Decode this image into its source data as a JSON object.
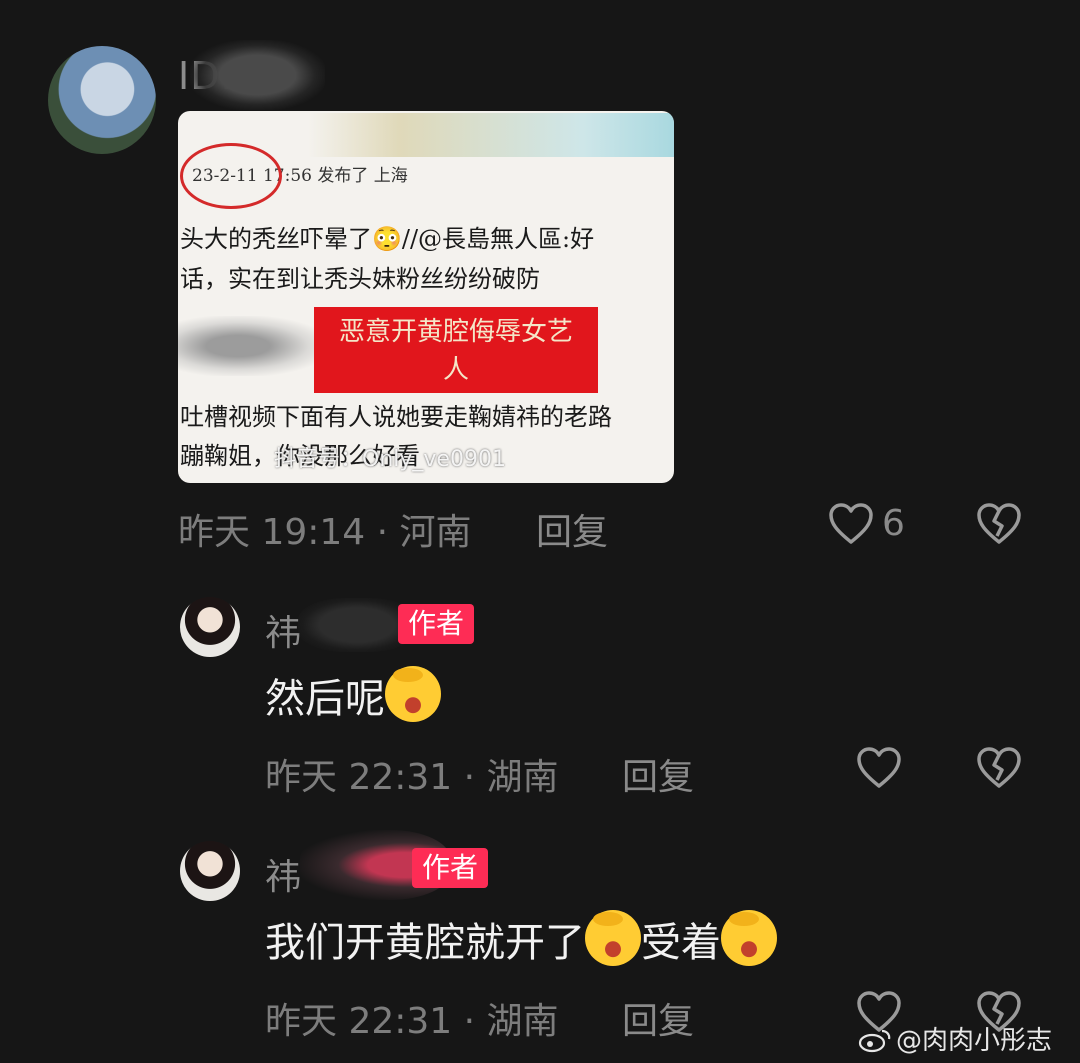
{
  "main_comment": {
    "username": "ID.",
    "timestamp": "昨天 19:14",
    "location": "河南",
    "reply_label": "回复",
    "like_count": "6",
    "screenshot": {
      "meta_text": "23-2-11 17:56 发布了 上海",
      "line1": "头大的秃丝吓晕了😳//@長島無人區:好",
      "line2": "话，实在到让秃头妹粉丝纷纷破防",
      "highlight_line1": "恶意开黄腔侮辱女艺",
      "highlight_line2": "人",
      "line3": "吐槽视频下面有人说她要走鞠婧祎的老路",
      "line4": "蹦鞠姐，你没那么好看",
      "watermark": "抖音号：Only_ve0901"
    }
  },
  "replies": [
    {
      "username": "祎",
      "badge": "作者",
      "text_before": "然后呢",
      "text_after": "",
      "emoji_name": "rolling-laughing-emoji",
      "timestamp": "昨天 22:31",
      "location": "湖南",
      "reply_label": "回复"
    },
    {
      "username": "祎",
      "badge": "作者",
      "text_before": "我们开黄腔就开了",
      "text_after": "受着",
      "emoji_name": "rolling-laughing-emoji",
      "timestamp": "昨天 22:31",
      "location": "湖南",
      "reply_label": "回复"
    }
  ],
  "credit": {
    "text": "@肉肉小彤志"
  },
  "colors": {
    "background": "#161616",
    "badge": "#fe2c55",
    "meta": "#7d7d7d"
  }
}
